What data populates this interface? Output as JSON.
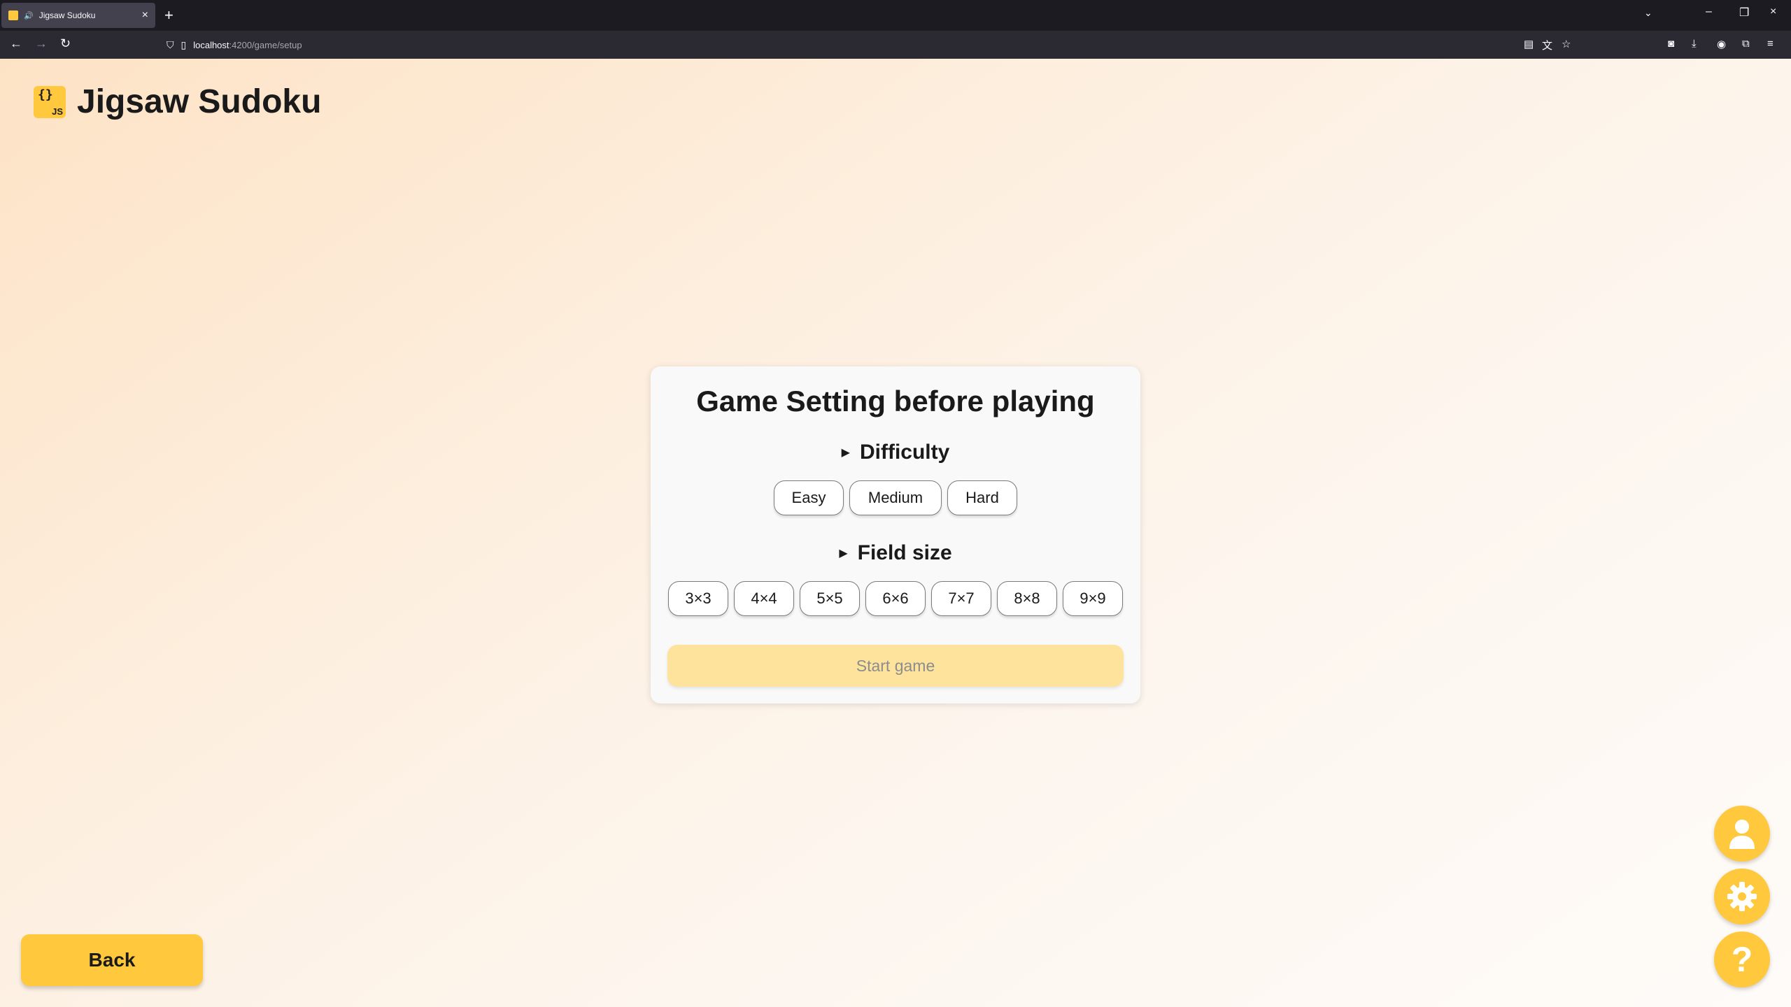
{
  "browser": {
    "tab_title": "Jigsaw Sudoku",
    "url_host": "localhost",
    "url_path": ":4200/game/setup"
  },
  "app": {
    "title": "Jigsaw Sudoku",
    "logo_braces": "{}",
    "logo_js": "JS"
  },
  "setup": {
    "heading": "Game Setting before playing",
    "difficulty_label": "Difficulty",
    "difficulty_options": [
      "Easy",
      "Medium",
      "Hard"
    ],
    "size_label": "Field size",
    "size_options": [
      "3×3",
      "4×4",
      "5×5",
      "6×6",
      "7×7",
      "8×8",
      "9×9"
    ],
    "start_label": "Start game"
  },
  "footer": {
    "back_label": "Back"
  },
  "colors": {
    "accent": "#ffc83d",
    "start_disabled": "#fde39c"
  }
}
